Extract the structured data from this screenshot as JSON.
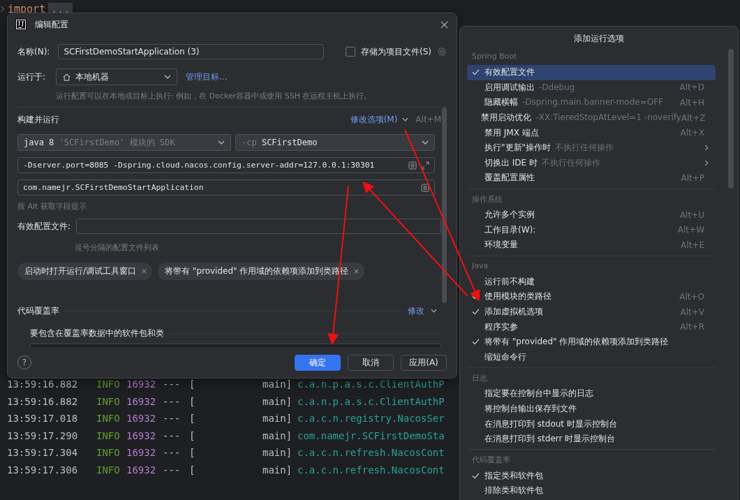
{
  "editor": {
    "keyword": "import",
    "fold": "..."
  },
  "console": [
    {
      "time": "13:59:16.882",
      "level": "INFO",
      "pid": "16932",
      "sep": "---",
      "bracket": "[",
      "thread": "main]",
      "logger": "c.a.n.p.a.s.c.ClientAuthP"
    },
    {
      "time": "13:59:16.882",
      "level": "INFO",
      "pid": "16932",
      "sep": "---",
      "bracket": "[",
      "thread": "main]",
      "logger": "c.a.n.p.a.s.c.ClientAuthP"
    },
    {
      "time": "13:59:17.018",
      "level": "INFO",
      "pid": "16932",
      "sep": "---",
      "bracket": "[",
      "thread": "main]",
      "logger": "c.a.c.n.registry.NacosSer"
    },
    {
      "time": "13:59:17.290",
      "level": "INFO",
      "pid": "16932",
      "sep": "---",
      "bracket": "[",
      "thread": "main]",
      "logger": "com.namejr.SCFirstDemoSta"
    },
    {
      "time": "13:59:17.304",
      "level": "INFO",
      "pid": "16932",
      "sep": "---",
      "bracket": "[",
      "thread": "main]",
      "logger": "c.a.c.n.refresh.NacosCont"
    },
    {
      "time": "13:59:17.306",
      "level": "INFO",
      "pid": "16932",
      "sep": "---",
      "bracket": "[",
      "thread": "main]",
      "logger": "c.a.c.n.refresh.NacosCont"
    }
  ],
  "dialog": {
    "title": "编辑配置",
    "name": {
      "label": "名称(N):",
      "value": "SCFirstDemoStartApplication (3)"
    },
    "store_option": {
      "label": "存储为项目文件(S)",
      "checked": false
    },
    "run_on": {
      "label": "运行于:",
      "value": "本地机器",
      "link": "管理目标...",
      "hint": "运行配置可以在本地或目标上执行: 例如，在 Docker容器中或使用 SSH 在远程主机上执行。"
    },
    "build_section": {
      "title": "构建并运行",
      "modify_link": "修改选项(M)",
      "shortcut": "Alt+M"
    },
    "jdk_select": {
      "value": "java 8",
      "detail": "'SCFirstDemo' 模块的 SDK"
    },
    "classpath_select": {
      "prefix": "-cp",
      "value": "SCFirstDemo"
    },
    "vm_options": {
      "value": "-Dserver.port=8085 -Dspring.cloud.nacos.config.server-addr=127.0.0.1:30301"
    },
    "main_class": {
      "value": "com.namejr.SCFirstDemoStartApplication"
    },
    "field_hint": "按 Alt 获取字段提示",
    "profiles": {
      "label": "有效配置文件:",
      "hint": "逗号分隔的配置文件列表"
    },
    "chips": [
      "启动时打开运行/调试工具窗口",
      "将带有 \"provided\" 作用域的依赖项添加到类路径"
    ],
    "coverage_section": {
      "title": "代码覆盖率",
      "modify_link": "修改",
      "subtitle": "要包含在覆盖率数据中的软件包和类"
    },
    "help": "?",
    "buttons": [
      {
        "label": "确定",
        "kind": "primary"
      },
      {
        "label": "取消",
        "kind": "normal"
      },
      {
        "label": "应用(A)",
        "kind": "normal"
      }
    ]
  },
  "menu": {
    "title": "添加运行选项",
    "groups": [
      {
        "header": "Spring Boot",
        "items": [
          {
            "label": "有效配置文件",
            "checked": true,
            "selected": true
          },
          {
            "label": "启用调试输出",
            "hint": "-Ddebug",
            "shortcut": "Alt+D",
            "checked": false,
            "selected": false
          },
          {
            "label": "隐藏横幅",
            "hint": "-Dspring.main.banner-mode=OFF",
            "shortcut": "Alt+H",
            "checked": false,
            "selected": false
          },
          {
            "label": "禁用启动优化",
            "hint": "-XX:TieredStopAtLevel=1 -noverify",
            "shortcut": "Alt+Z",
            "checked": false,
            "selected": false
          },
          {
            "label": "禁用 JMX 端点",
            "shortcut": "Alt+X",
            "checked": false,
            "selected": false
          },
          {
            "label": "执行\"更新\"操作时",
            "hint": "不执行任何操作",
            "submenu": true,
            "checked": false,
            "selected": false
          },
          {
            "label": "切换出 IDE 时",
            "hint": "不执行任何操作",
            "submenu": true,
            "checked": false,
            "selected": false
          },
          {
            "label": "覆盖配置属性",
            "shortcut": "Alt+P",
            "checked": false,
            "selected": false
          }
        ]
      },
      {
        "header": "操作系统",
        "items": [
          {
            "label": "允许多个实例",
            "shortcut": "Alt+U",
            "checked": false,
            "selected": false
          },
          {
            "label": "工作目录(W):",
            "shortcut": "Alt+W",
            "checked": false,
            "selected": false
          },
          {
            "label": "环境变量",
            "shortcut": "Alt+E",
            "checked": false,
            "selected": false
          }
        ]
      },
      {
        "header": "Java",
        "items": [
          {
            "label": "运行前不构建",
            "checked": false,
            "selected": false
          },
          {
            "label": "使用模块的类路径",
            "shortcut": "Alt+O",
            "checked": true,
            "selected": false
          },
          {
            "label": "添加虚拟机选项",
            "shortcut": "Alt+V",
            "checked": true,
            "selected": false
          },
          {
            "label": "程序实参",
            "shortcut": "Alt+R",
            "checked": false,
            "selected": false
          },
          {
            "label": "将带有 \"provided\" 作用域的依赖项添加到类路径",
            "checked": true,
            "selected": false
          },
          {
            "label": "缩短命令行",
            "checked": false,
            "selected": false
          }
        ]
      },
      {
        "header": "日志",
        "items": [
          {
            "label": "指定要在控制台中显示的日志",
            "checked": false,
            "selected": false
          },
          {
            "label": "将控制台输出保存到文件",
            "checked": false,
            "selected": false
          },
          {
            "label": "在消息打印到 stdout 时显示控制台",
            "checked": false,
            "selected": false
          },
          {
            "label": "在消息打印到 stderr 时显示控制台",
            "checked": false,
            "selected": false
          }
        ]
      },
      {
        "header": "代码覆盖率",
        "items": [
          {
            "label": "指定类和软件包",
            "checked": true,
            "selected": false
          },
          {
            "label": "排除类和软件包",
            "checked": false,
            "selected": false
          }
        ]
      }
    ]
  }
}
